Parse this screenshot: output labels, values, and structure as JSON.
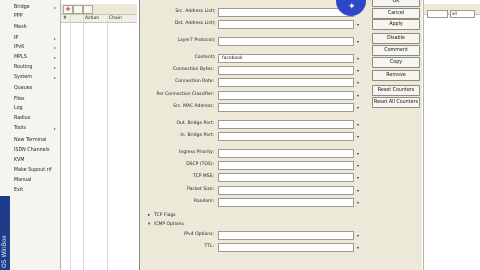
{
  "sidebar": {
    "items": [
      {
        "label": "Bridge",
        "submenu": true
      },
      {
        "label": "PPP",
        "submenu": false
      },
      {
        "label": "Mesh",
        "submenu": false
      },
      {
        "label": "IP",
        "submenu": true
      },
      {
        "label": "IPv6",
        "submenu": true
      },
      {
        "label": "MPLS",
        "submenu": true
      },
      {
        "label": "Routing",
        "submenu": true
      },
      {
        "label": "System",
        "submenu": true
      },
      {
        "label": "Queues",
        "submenu": false
      },
      {
        "label": "Files",
        "submenu": false
      },
      {
        "label": "Log",
        "submenu": false
      },
      {
        "label": "Radius",
        "submenu": false
      },
      {
        "label": "Tools",
        "submenu": true
      },
      {
        "label": "New Terminal",
        "submenu": false
      },
      {
        "label": "ISDN Channels",
        "submenu": false
      },
      {
        "label": "KVM",
        "submenu": false
      },
      {
        "label": "Make Supout.rif",
        "submenu": false
      },
      {
        "label": "Manual",
        "submenu": false
      },
      {
        "label": "Exit",
        "submenu": false
      }
    ],
    "brand": "OS WinBox"
  },
  "list_panel": {
    "columns": [
      "#",
      "Action",
      "Chain"
    ]
  },
  "dialog": {
    "fields": [
      {
        "label": "Src. Address List:",
        "value": "",
        "bang": true
      },
      {
        "label": "Dst. Address List:",
        "value": "",
        "bang": true
      },
      {
        "label": "Layer7 Protocol:",
        "value": "",
        "bang": true
      },
      {
        "label": "Content:",
        "value": "facebook",
        "bang": true
      },
      {
        "label": "Connection Bytes:",
        "value": "",
        "bang": false
      },
      {
        "label": "Connection Rate:",
        "value": "",
        "bang": false
      },
      {
        "label": "Per Connection Classifier:",
        "value": "",
        "bang": false
      },
      {
        "label": "Src. MAC Address:",
        "value": "",
        "bang": false
      },
      {
        "label": "Out. Bridge Port:",
        "value": "",
        "bang": false
      },
      {
        "label": "In. Bridge Port:",
        "value": "",
        "bang": false
      },
      {
        "label": "Ingress Priority:",
        "value": "",
        "bang": false
      },
      {
        "label": "DSCP (TOS):",
        "value": "",
        "bang": false
      },
      {
        "label": "TCP MSS:",
        "value": "",
        "bang": false
      },
      {
        "label": "Packet Size:",
        "value": "",
        "bang": false
      },
      {
        "label": "Random:",
        "value": "",
        "bang": false
      }
    ],
    "sections": [
      {
        "label": "TCP Flags",
        "expanded": false
      },
      {
        "label": "ICMP Options",
        "expanded": true
      }
    ],
    "icmp_fields": [
      {
        "label": "IPv4 Options:",
        "value": ""
      },
      {
        "label": "TTL:",
        "value": ""
      }
    ]
  },
  "buttons": [
    "OK",
    "Cancel",
    "Apply",
    "Disable",
    "Comment",
    "Copy",
    "Remove",
    "Reset Counters",
    "Reset All Counters"
  ],
  "bg_window": {
    "filter_value": "all"
  },
  "colors": {
    "dialog_bg": "#ece9d8",
    "cursor_highlight": "#2c47c8",
    "brand_strip": "#1f3c8a"
  }
}
